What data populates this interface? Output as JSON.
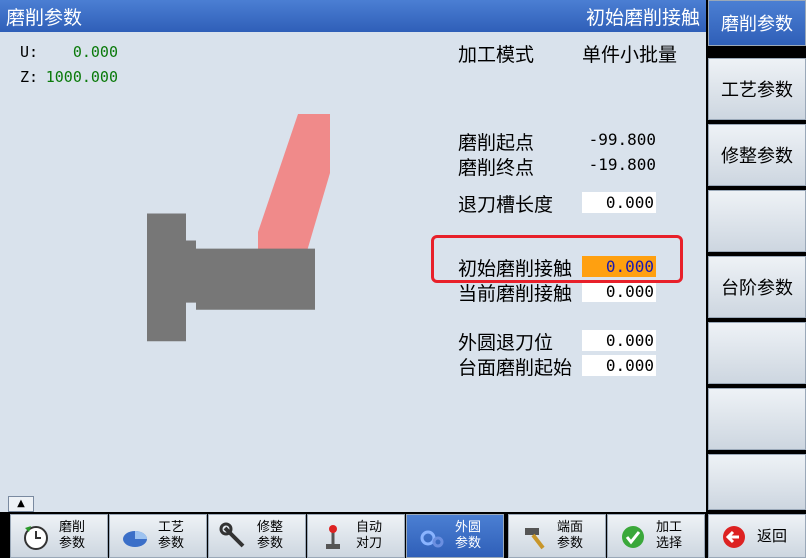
{
  "title": {
    "left": "磨削参数",
    "right": "初始磨削接触"
  },
  "coords": [
    {
      "label": "U:",
      "value": "0.000"
    },
    {
      "label": "Z:",
      "value": "1000.000"
    }
  ],
  "mode": {
    "label": "加工模式",
    "value": "单件小批量"
  },
  "params": {
    "start_label": "磨削起点",
    "start_value": "-99.800",
    "end_label": "磨削终点",
    "end_value": "-19.800",
    "groove_label": "退刀槽长度",
    "groove_value": "0.000",
    "initial_label": "初始磨削接触",
    "initial_value": "0.000",
    "current_label": "当前磨削接触",
    "current_value": "0.000",
    "od_retract_label": "外圆退刀位",
    "od_retract_value": "0.000",
    "face_start_label": "台面磨削起始",
    "face_start_value": "0.000"
  },
  "softkeys": [
    "磨削参数",
    "工艺参数",
    "修整参数",
    "",
    "台阶参数",
    "",
    "",
    ""
  ],
  "bottom": [
    {
      "line1": "磨削",
      "line2": "参数",
      "icon": "clock-icon"
    },
    {
      "line1": "工艺",
      "line2": "参数",
      "icon": "pie-icon"
    },
    {
      "line1": "修整",
      "line2": "参数",
      "icon": "wrench-icon"
    },
    {
      "line1": "自动",
      "line2": "对刀",
      "icon": "joystick-icon"
    },
    {
      "line1": "外圆",
      "line2": "参数",
      "icon": "gears-icon"
    },
    {
      "line1": "端面",
      "line2": "参数",
      "icon": "hammer-icon"
    },
    {
      "line1": "加工",
      "line2": "选择",
      "icon": "check-icon"
    },
    {
      "line1": "返回",
      "line2": "",
      "icon": "back-icon"
    }
  ],
  "colors": {
    "title_bg": "#2f5fb8",
    "active_field": "#ffa010",
    "highlight": "#e8202a",
    "wheel": "#f08a8a",
    "workpiece": "#777777"
  }
}
